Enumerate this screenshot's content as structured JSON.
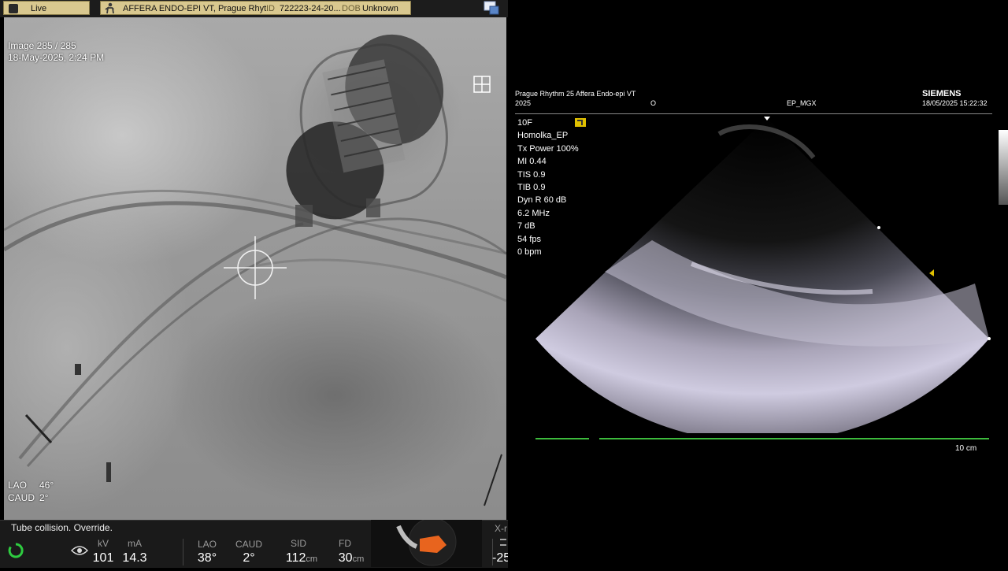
{
  "fluoro": {
    "live_label": "Live",
    "patient_name": "AFFERA ENDO-EPI VT, Prague Rhyt...",
    "id_label": "ID",
    "id_value": "722223-24-20...",
    "dob_label": "DOB",
    "dob_value": "Unknown",
    "image_counter": "Image 285 / 285",
    "timestamp": "18-May-2025, 2:24 PM",
    "angle1_label": "LAO",
    "angle1_value": "46°",
    "angle2_label": "CAUD",
    "angle2_value": "2°"
  },
  "status": {
    "message": "Tube collision. Override.",
    "kv_label": "kV",
    "kv_value": "101",
    "ma_label": "mA",
    "ma_value": "14.3",
    "lao_label": "LAO",
    "lao_value": "38°",
    "caud_label": "CAUD",
    "caud_value": "2°",
    "sid_label": "SID",
    "sid_value": "112",
    "sid_unit": "cm",
    "fd_label": "FD",
    "fd_value": "30",
    "fd_unit": "cm",
    "xr_label": "X-r",
    "xr_value": "-25"
  },
  "echo": {
    "header_left_line1": "Prague Rhythm 25 Affera Endo-epi VT",
    "header_left_line2": "2025",
    "header_mid_o": "O",
    "header_preset": "EP_MGX",
    "vendor": "SIEMENS",
    "datetime": "18/05/2025 15:22:32",
    "params": [
      "10F",
      "Homolka_EP",
      "Tx Power 100%",
      "MI 0.44",
      "TIS 0.9",
      "TIB 0.9",
      "Dyn R 60 dB",
      "6.2 MHz",
      "7 dB",
      "54 fps",
      "0 bpm"
    ],
    "depth_label": "10 cm"
  },
  "colors": {
    "chip_bg": "#d9c88f",
    "accent_green": "#3dbb3d",
    "probe_orange": "#e8641e"
  }
}
